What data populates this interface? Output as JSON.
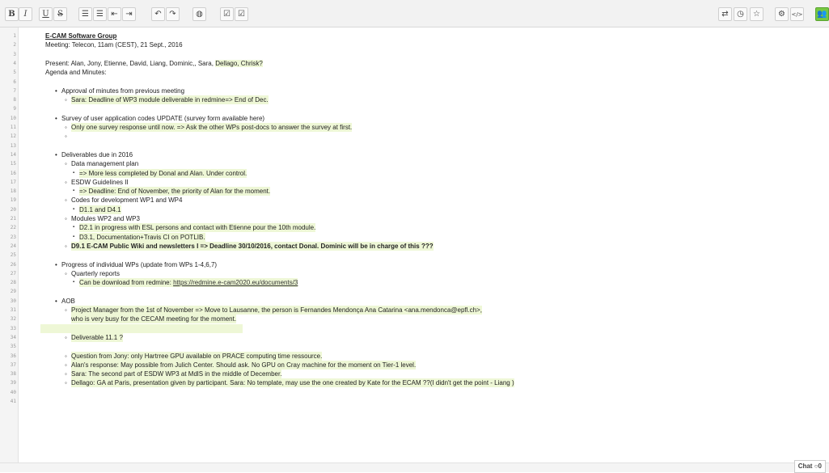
{
  "toolbar": {
    "left": [
      {
        "name": "bold-button",
        "label": "B",
        "cls": "serif b"
      },
      {
        "name": "italic-button",
        "label": "I",
        "cls": "serif"
      },
      {
        "name": "underline-button",
        "label": "U",
        "cls": "serif"
      },
      {
        "name": "strikethrough-button",
        "label": "S",
        "cls": "serif"
      },
      {
        "name": "ordered-list-button",
        "label": "☰"
      },
      {
        "name": "unordered-list-button",
        "label": "☰"
      },
      {
        "name": "outdent-button",
        "label": "⇤"
      },
      {
        "name": "indent-button",
        "label": "⇥"
      },
      {
        "name": "undo-button",
        "label": "↶"
      },
      {
        "name": "redo-button",
        "label": "↷"
      },
      {
        "name": "clear-authorship-button",
        "label": "◍"
      },
      {
        "name": "checkbox-button",
        "label": "☑"
      },
      {
        "name": "checkbox-2-button",
        "label": "☑"
      }
    ],
    "right": [
      {
        "name": "import-export-button",
        "label": "⇄"
      },
      {
        "name": "history-button",
        "label": "◷"
      },
      {
        "name": "star-button",
        "label": "☆"
      },
      {
        "name": "settings-button",
        "label": "⚙"
      },
      {
        "name": "embed-button",
        "label": "</>"
      },
      {
        "name": "users-button",
        "label": "👥",
        "active": true
      }
    ]
  },
  "lines": [
    {
      "n": "1",
      "text": "E-CAM  Software Group",
      "cls": "u b",
      "indent": 0
    },
    {
      "n": "2",
      "text": "Meeting: Telecon, 11am (CEST), 21 Sept., 2016",
      "indent": 0
    },
    {
      "n": "3",
      "text": "",
      "indent": 0
    },
    {
      "n": "4",
      "text": "Present:  Alan, Jony, Etienne, David, Liang, Dominic,, Sara, ",
      "tail": "Dellago, Chrisk?",
      "indent": 0
    },
    {
      "n": "5",
      "text": "Agenda and Minutes:",
      "indent": 0
    },
    {
      "n": "6",
      "text": "",
      "indent": 0
    },
    {
      "n": "7",
      "text": "Approval of minutes from previous meeting",
      "bullet": "•",
      "indent": 1
    },
    {
      "n": "8",
      "text": "Sara: Deadline of WP3 module deliverable  in redmine=> End of Dec.",
      "bullet": "◦",
      "indent": 2,
      "hl": true
    },
    {
      "n": "9",
      "text": "",
      "indent": 0
    },
    {
      "n": "10",
      "text": "Survey of user application codes UPDATE (survey form available here)",
      "bullet": "•",
      "indent": 1
    },
    {
      "n": "11",
      "text": "Only one survey response until now. => Ask the other WPs post-docs to answer the survey at first.",
      "bullet": "◦",
      "indent": 2,
      "hl": true
    },
    {
      "n": "12",
      "text": "",
      "bullet": "◦",
      "indent": 2
    },
    {
      "n": "13",
      "text": "",
      "indent": 0
    },
    {
      "n": "14",
      "text": "Deliverables due in 2016",
      "bullet": "•",
      "indent": 1
    },
    {
      "n": "15",
      "text": "Data management plan",
      "bullet": "◦",
      "indent": 2
    },
    {
      "n": "16",
      "text": "=> More less completed by Donal and Alan. Under control.",
      "bullet": "▪",
      "indent": 3,
      "hl": true
    },
    {
      "n": "17",
      "text": "ESDW Guidelines II",
      "bullet": "◦",
      "indent": 2
    },
    {
      "n": "18",
      "text": "=> Deadline: End of November, the priority of Alan for the moment.",
      "bullet": "▪",
      "indent": 3,
      "hl": true
    },
    {
      "n": "19",
      "text": "Codes for development WP1 and WP4",
      "bullet": "◦",
      "indent": 2
    },
    {
      "n": "20",
      "text": "D1.1 and D4.1",
      "bullet": "▪",
      "indent": 3,
      "hl": true
    },
    {
      "n": "21",
      "text": "Modules WP2 and WP3",
      "bullet": "◦",
      "indent": 2
    },
    {
      "n": "22",
      "text": "D2.1 in progress with ESL persons and contact with Etienne pour the 10th module.",
      "bullet": "▪",
      "indent": 3,
      "hl": true
    },
    {
      "n": "23",
      "text": "D3.1, Documentation+Travis CI on POTLIB.",
      "bullet": "▪",
      "indent": 3,
      "hl": true
    },
    {
      "n": "24",
      "text": "D9.1 E-CAM Public Wiki and newsletters I => Deadline 30/10/2016, contact Donal. Dominic will be in charge of this ???",
      "bullet": "◦",
      "indent": 2,
      "hl": true,
      "cls": "b"
    },
    {
      "n": "25",
      "text": "",
      "indent": 0
    },
    {
      "n": "26",
      "text": "Progress of individual WPs (update from WPs 1-4,6,7)",
      "bullet": "•",
      "indent": 1
    },
    {
      "n": "27",
      "text": "Quarterly reports",
      "bullet": "◦",
      "indent": 2
    },
    {
      "n": "28",
      "text": "Can be download from redmine: ",
      "link": "https://redmine.e-cam2020.eu/documents/3",
      "bullet": "▪",
      "indent": 3,
      "hl": true
    },
    {
      "n": "29",
      "text": "",
      "indent": 0
    },
    {
      "n": "30",
      "text": "AOB",
      "bullet": "•",
      "indent": 1
    },
    {
      "n": "31",
      "text": "Project Manager from the 1st of November => Move to Lausanne, the person is  Fernandes Mendonça Ana Catarina <ana.mendonca@epfl.ch>,",
      "bullet": "◦",
      "indent": 2,
      "hl": true
    },
    {
      "n": "32",
      "text": "who is very busy for the CECAM meeting for the moment.",
      "indent": 2,
      "hl": true
    },
    {
      "n": "33",
      "text": "",
      "indent": 0,
      "hlblock": true
    },
    {
      "n": "34",
      "text": "Deliverable 11.1 ?",
      "bullet": "◦",
      "indent": 2,
      "hl": true
    },
    {
      "n": "35",
      "text": "",
      "indent": 0
    },
    {
      "n": "36",
      "text": "Question from Jony: only Hartrree GPU available on PRACE computing time ressource.",
      "bullet": "◦",
      "indent": 2,
      "hl": true
    },
    {
      "n": "37",
      "text": "Alan's response: May possible from Julich Center. Should ask.  No GPU on Cray machine for the moment on Tier-1 level.",
      "bullet": "◦",
      "indent": 2,
      "hl": true
    },
    {
      "n": "38",
      "text": "Sara: The second part of ESDW WP3 at MdlS in the middle of December.",
      "bullet": "◦",
      "indent": 2,
      "hl": true
    },
    {
      "n": "39",
      "text": "Dellago: GA at Paris, presentation given by participant.  Sara: No template, may use the one created by Kate for the ECAM ??(I didn't get the point - Liang )",
      "bullet": "◦",
      "indent": 2,
      "hl": true
    },
    {
      "n": "40",
      "text": "",
      "indent": 0
    },
    {
      "n": "41",
      "text": "",
      "indent": 0
    }
  ],
  "chat": {
    "label": "Chat",
    "count": "0"
  }
}
